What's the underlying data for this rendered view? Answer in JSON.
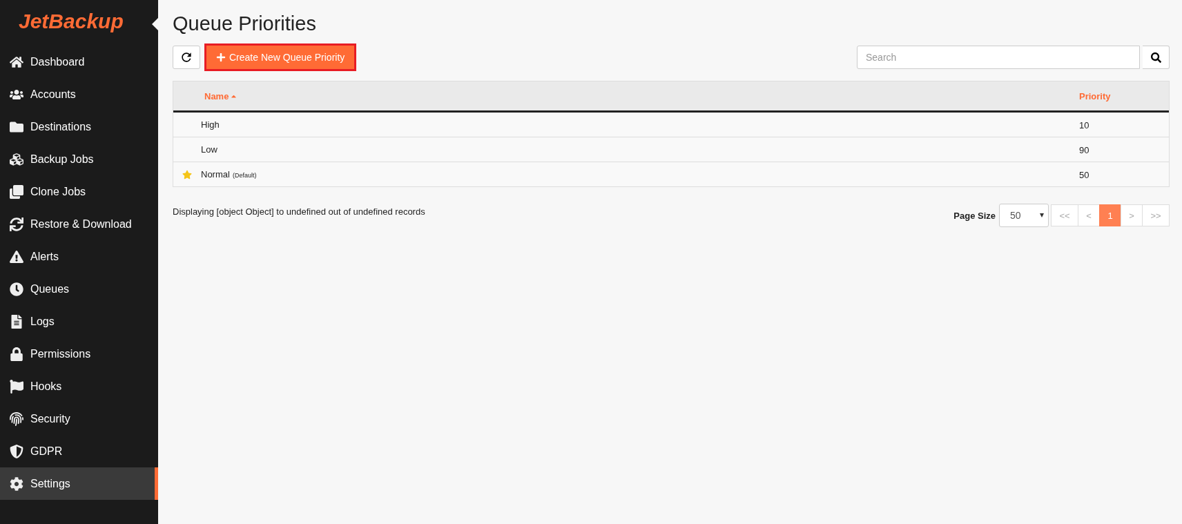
{
  "logo": "JetBackup",
  "sidebar": {
    "items": [
      {
        "label": "Dashboard",
        "selected": false
      },
      {
        "label": "Accounts",
        "selected": false
      },
      {
        "label": "Destinations",
        "selected": false
      },
      {
        "label": "Backup Jobs",
        "selected": false
      },
      {
        "label": "Clone Jobs",
        "selected": false
      },
      {
        "label": "Restore & Download",
        "selected": false
      },
      {
        "label": "Alerts",
        "selected": false
      },
      {
        "label": "Queues",
        "selected": false
      },
      {
        "label": "Logs",
        "selected": false
      },
      {
        "label": "Permissions",
        "selected": false
      },
      {
        "label": "Hooks",
        "selected": false
      },
      {
        "label": "Security",
        "selected": false
      },
      {
        "label": "GDPR",
        "selected": false
      },
      {
        "label": "Settings",
        "selected": true
      }
    ]
  },
  "page_title": "Queue Priorities",
  "toolbar": {
    "create_button": {
      "label": "Create New Queue Priority",
      "highlighted": true
    },
    "search": {
      "placeholder": "Search"
    }
  },
  "table": {
    "columns": [
      {
        "label": "Name",
        "sorted": true
      },
      {
        "label": "Priority",
        "sorted": false
      }
    ],
    "rows": [
      {
        "starred": false,
        "name": "High",
        "note": "",
        "priority": "10"
      },
      {
        "starred": false,
        "name": "Low",
        "note": "",
        "priority": "90"
      },
      {
        "starred": true,
        "name": "Normal",
        "note": "(Default)",
        "priority": "50"
      }
    ]
  },
  "summary": "Displaying [object Object] to undefined out of undefined records",
  "pagination": {
    "page_size_label": "Page Size",
    "page_size": "50",
    "pages": [
      {
        "label": "<<",
        "selected": false
      },
      {
        "label": "<",
        "selected": false
      },
      {
        "label": "1",
        "selected": true
      },
      {
        "label": ">",
        "selected": false
      },
      {
        "label": ">>",
        "selected": false
      }
    ]
  }
}
